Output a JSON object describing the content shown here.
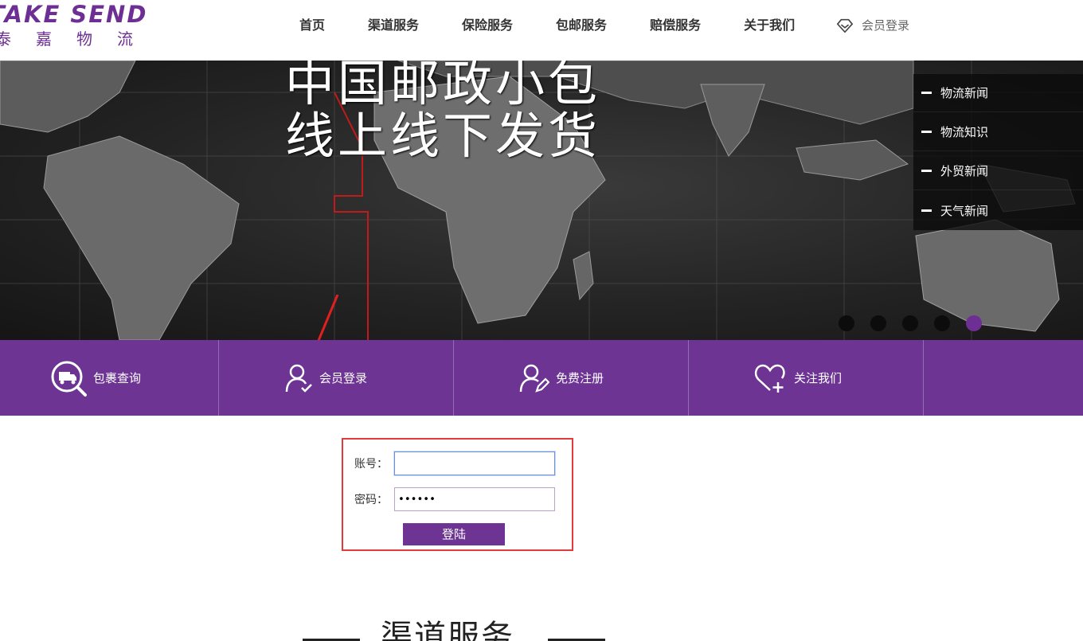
{
  "header": {
    "logo_en": "TAKE SEND",
    "logo_cn": "泰嘉物流",
    "nav": [
      "首页",
      "渠道服务",
      "保险服务",
      "包邮服务",
      "赔偿服务",
      "关于我们"
    ],
    "member_login": "会员登录"
  },
  "banner": {
    "line1": "中国邮政小包",
    "line2": "线上线下发货",
    "news_menu": [
      "物流新闻",
      "物流知识",
      "外贸新闻",
      "天气新闻"
    ],
    "slide_count": 5,
    "active_slide": 5
  },
  "quickbar": {
    "items": [
      {
        "label": "包裹查询",
        "icon": "parcel-search-icon"
      },
      {
        "label": "会员登录",
        "icon": "user-check-icon"
      },
      {
        "label": "免费注册",
        "icon": "user-edit-icon"
      },
      {
        "label": "关注我们",
        "icon": "heart-plus-icon"
      }
    ]
  },
  "login": {
    "account_label": "账号：",
    "account_value": "",
    "password_label": "密码：",
    "password_value": "123456",
    "submit_label": "登陆"
  },
  "section": {
    "title": "渠道服务"
  },
  "colors": {
    "brand_purple": "#6d3494",
    "highlight_red": "#e23b3b"
  }
}
